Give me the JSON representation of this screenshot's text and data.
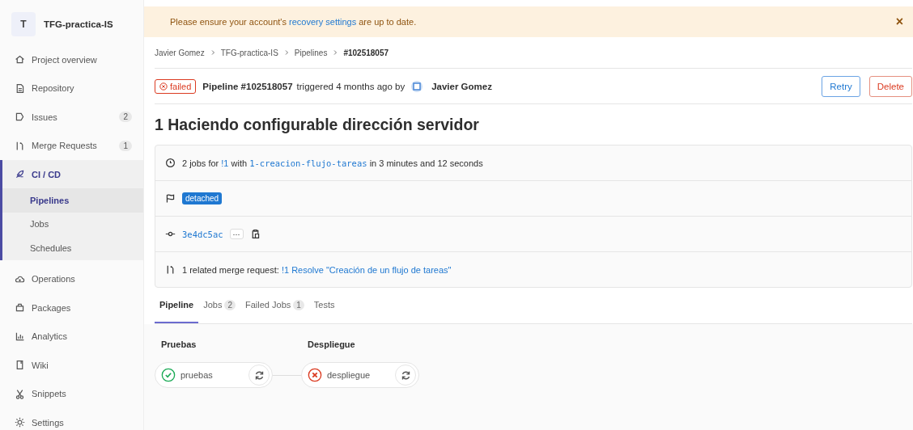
{
  "project": {
    "initial": "T",
    "name": "TFG-practica-IS"
  },
  "sidebar": {
    "items": [
      {
        "label": "Project overview",
        "selected": false
      },
      {
        "label": "Repository",
        "selected": false
      },
      {
        "label": "Issues",
        "badge": "2",
        "selected": false
      },
      {
        "label": "Merge Requests",
        "badge": "1",
        "selected": false
      },
      {
        "label": "CI / CD",
        "selected": true,
        "children": [
          {
            "label": "Pipelines",
            "selected": true
          },
          {
            "label": "Jobs",
            "selected": false
          },
          {
            "label": "Schedules",
            "selected": false
          }
        ]
      },
      {
        "label": "Operations",
        "selected": false
      },
      {
        "label": "Packages",
        "selected": false
      },
      {
        "label": "Analytics",
        "selected": false
      },
      {
        "label": "Wiki",
        "selected": false
      },
      {
        "label": "Snippets",
        "selected": false
      },
      {
        "label": "Settings",
        "selected": false
      }
    ]
  },
  "banner": {
    "before": "Please ensure your account's",
    "link": "recovery settings",
    "after": "are up to date.",
    "close": "×"
  },
  "breadcrumbs": [
    {
      "label": "Javier Gomez",
      "current": false
    },
    {
      "label": "TFG-practica-IS",
      "current": false
    },
    {
      "label": "Pipelines",
      "current": false
    },
    {
      "label": "#102518057",
      "current": true
    }
  ],
  "header": {
    "status": "failed",
    "title": "Pipeline #102518057",
    "triggered": "triggered 4 months ago by",
    "user": "Javier Gomez",
    "buttons": [
      {
        "label": "Retry",
        "kind": "primary"
      },
      {
        "label": "Delete",
        "kind": "danger"
      }
    ]
  },
  "page_title": "1 Haciendo configurable dirección servidor",
  "info": {
    "jobs_before": "2 jobs for",
    "mr_link": "!1",
    "with": "with",
    "branch": "1-creacion-flujo-tareas",
    "duration": "in 3 minutes and 12 seconds",
    "tag": "detached",
    "commit": "3e4dc5ac",
    "more": "···",
    "related_before": "1 related merge request:",
    "related_link": "!1 Resolve \"Creación de un flujo de tareas\""
  },
  "tabs": [
    {
      "label": "Pipeline",
      "selected": true
    },
    {
      "label": "Jobs",
      "count": "2",
      "selected": false
    },
    {
      "label": "Failed Jobs",
      "count": "1",
      "selected": false
    },
    {
      "label": "Tests",
      "selected": false
    }
  ],
  "stages": [
    {
      "title": "Pruebas",
      "jobs": [
        {
          "name": "pruebas",
          "failed": false
        }
      ]
    },
    {
      "title": "Despliegue",
      "jobs": [
        {
          "name": "despliegue",
          "failed": true
        }
      ]
    }
  ]
}
